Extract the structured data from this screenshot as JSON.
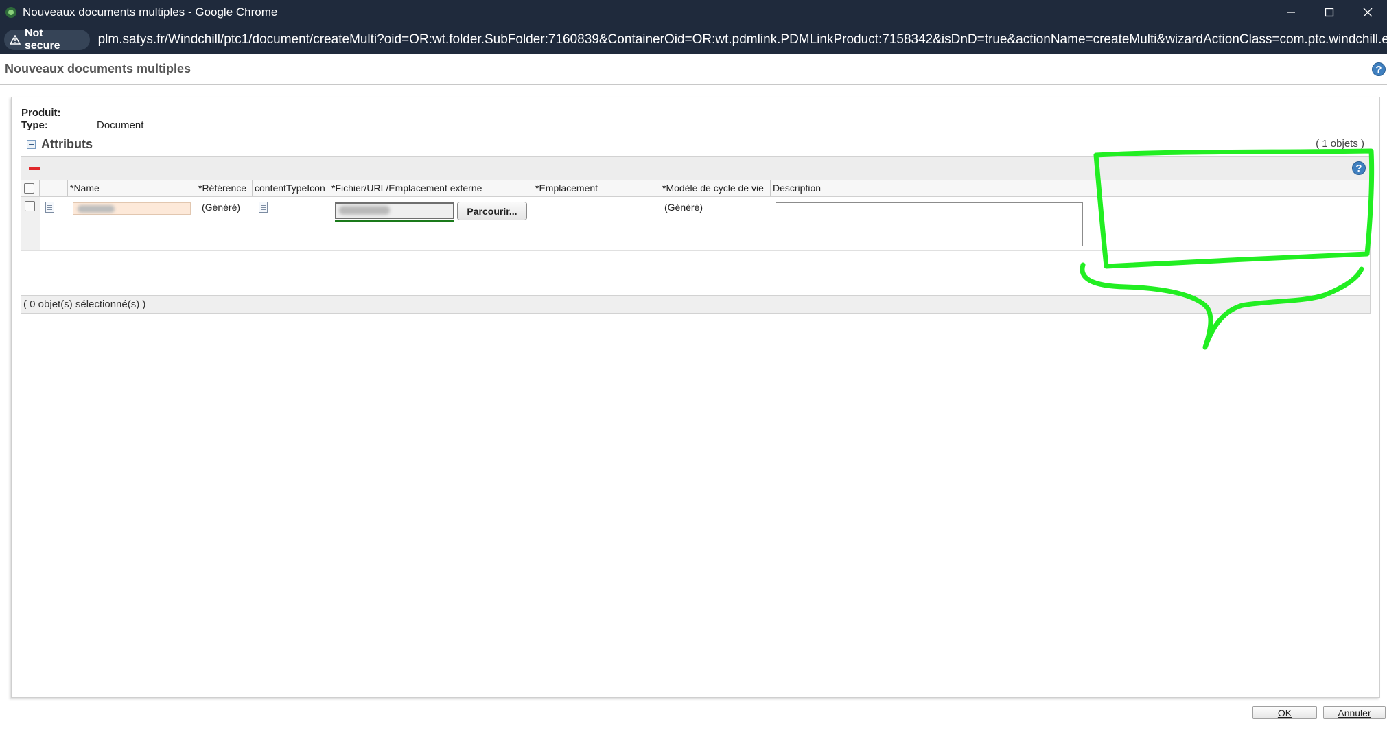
{
  "window": {
    "title": "Nouveaux documents multiples - Google Chrome",
    "controls": [
      "minimize-icon",
      "maximize-icon",
      "close-icon"
    ]
  },
  "addressbar": {
    "security_label": "Not secure",
    "url": "plm.satys.fr/Windchill/ptc1/document/createMulti?oid=OR:wt.folder.SubFolder:7160839&ContainerOid=OR:wt.pdmlink.PDMLinkProduct:7158342&isDnD=true&actionName=createMulti&wizardActionClass=com.ptc.windchill.enterprise.doc.f..."
  },
  "page": {
    "title": "Nouveaux documents multiples"
  },
  "info": {
    "product_label": "Produit:",
    "product_value": "",
    "type_label": "Type:",
    "type_value": "Document"
  },
  "attributes": {
    "title": "Attributs",
    "object_count": "( 1 objets )",
    "columns": [
      "*Name",
      "*Référence",
      "contentTypeIcon",
      "*Fichier/URL/Emplacement externe",
      "*Emplacement",
      "*Modèle de cycle de vie",
      "Description"
    ],
    "rows": [
      {
        "reference": "(Généré)",
        "browse_label": "Parcourir...",
        "lifecycle": "(Généré)",
        "description": ""
      }
    ],
    "selection_status": "( 0 objet(s) sélectionné(s) )"
  },
  "buttons": {
    "ok": "OK",
    "cancel": "Annuler"
  },
  "colors": {
    "chrome_bar": "#1f2a3c",
    "annotation": "#22ee22",
    "remove_action": "#e0282b",
    "help_icon": "#3f7fbf",
    "required_field": "#fde9d9"
  }
}
